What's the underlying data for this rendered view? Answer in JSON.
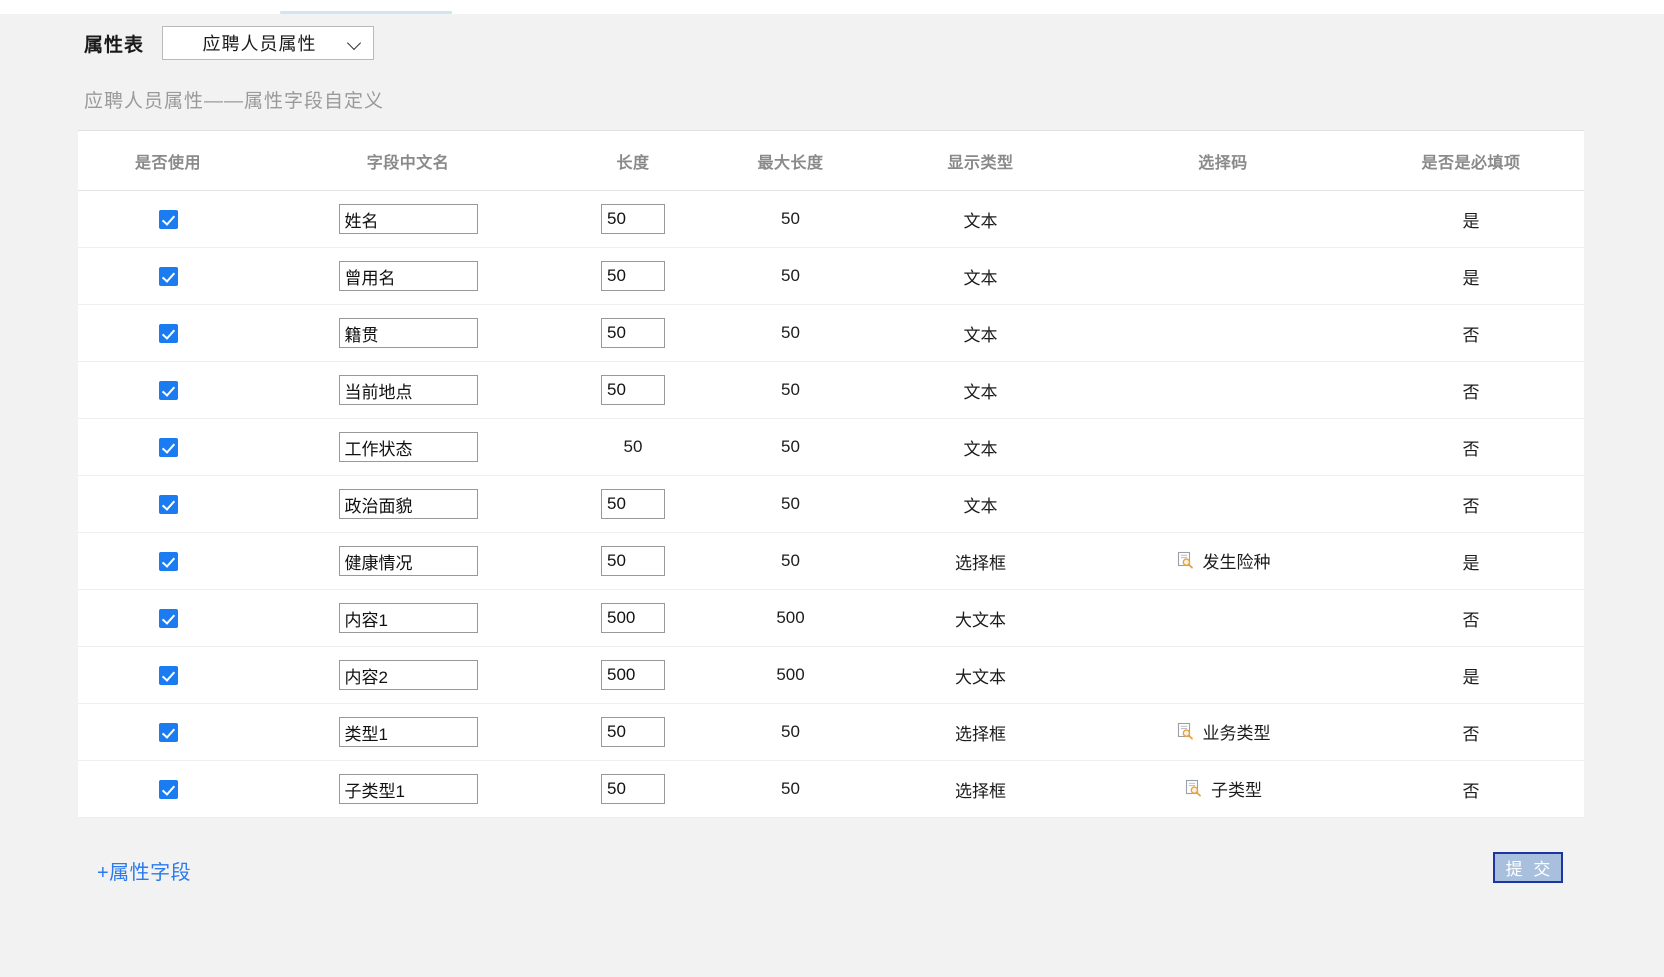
{
  "header": {
    "label": "属性表",
    "select_value": "应聘人员属性",
    "chevron_icon": "chevron-down-icon"
  },
  "subtitle": "应聘人员属性——属性字段自定义",
  "table": {
    "columns": [
      "是否使用",
      "字段中文名",
      "长度",
      "最大长度",
      "显示类型",
      "选择码",
      "是否是必填项"
    ],
    "rows": [
      {
        "use": true,
        "name": "姓名",
        "len": "50",
        "len_editable": true,
        "max": "50",
        "display": "文本",
        "code": "",
        "required": "是"
      },
      {
        "use": true,
        "name": "曾用名",
        "len": "50",
        "len_editable": true,
        "max": "50",
        "display": "文本",
        "code": "",
        "required": "是"
      },
      {
        "use": true,
        "name": "籍贯",
        "len": "50",
        "len_editable": true,
        "max": "50",
        "display": "文本",
        "code": "",
        "required": "否"
      },
      {
        "use": true,
        "name": "当前地点",
        "len": "50",
        "len_editable": true,
        "max": "50",
        "display": "文本",
        "code": "",
        "required": "否"
      },
      {
        "use": true,
        "name": "工作状态",
        "len": "50",
        "len_editable": false,
        "max": "50",
        "display": "文本",
        "code": "",
        "required": "否"
      },
      {
        "use": true,
        "name": "政治面貌",
        "len": "50",
        "len_editable": true,
        "max": "50",
        "display": "文本",
        "code": "",
        "required": "否"
      },
      {
        "use": true,
        "name": "健康情况",
        "len": "50",
        "len_editable": true,
        "max": "50",
        "display": "选择框",
        "code": "发生险种",
        "required": "是"
      },
      {
        "use": true,
        "name": "内容1",
        "len": "500",
        "len_editable": true,
        "max": "500",
        "display": "大文本",
        "code": "",
        "required": "否"
      },
      {
        "use": true,
        "name": "内容2",
        "len": "500",
        "len_editable": true,
        "max": "500",
        "display": "大文本",
        "code": "",
        "required": "是"
      },
      {
        "use": true,
        "name": "类型1",
        "len": "50",
        "len_editable": true,
        "max": "50",
        "display": "选择框",
        "code": "业务类型",
        "required": "否"
      },
      {
        "use": true,
        "name": "子类型1",
        "len": "50",
        "len_editable": true,
        "max": "50",
        "display": "选择框",
        "code": "子类型",
        "required": "否"
      }
    ]
  },
  "footer": {
    "add_field_label": "+属性字段",
    "submit_label": "提 交"
  },
  "colors": {
    "accent_blue": "#1a7cf0",
    "link_blue": "#2a7bf0",
    "submit_fill": "#a8c0de",
    "submit_border": "#1c35a0",
    "page_bg": "#f2f2f2",
    "card_bg": "#ffffff",
    "header_text": "#8a8a8a",
    "subtitle_text": "#9a9a9a",
    "lookup_icon_accent": "#e8a33d"
  },
  "icons": {
    "lookup": "lookup-search-icon",
    "checkbox_checked": "checkbox-checked-icon"
  }
}
